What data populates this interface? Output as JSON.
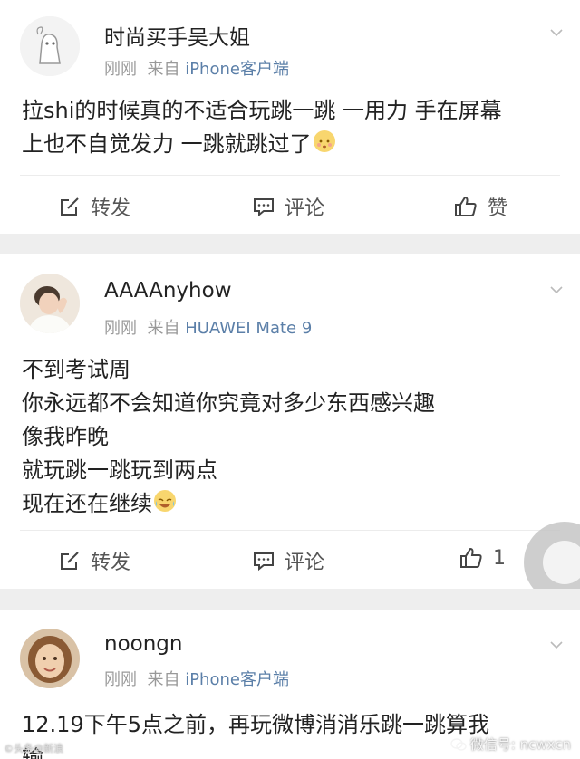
{
  "posts": [
    {
      "user": "时尚买手吴大姐",
      "time": "刚刚",
      "from": "来自",
      "source": "iPhone客户端",
      "lines": [
        "拉shi的时候真的不适合玩跳一跳 一用力 手在屏幕",
        "上也不自觉发力 一跳就跳过了"
      ],
      "emoji": "embarrassed-emoji",
      "actions": {
        "repost": "转发",
        "comment": "评论",
        "like": "赞"
      }
    },
    {
      "user": "AAAAnyhow",
      "time": "刚刚",
      "from": "来自",
      "source": "HUAWEI Mate 9",
      "lines": [
        "不到考试周",
        "你永远都不会知道你究竟对多少东西感兴趣",
        "像我昨晚",
        "就玩跳一跳玩到两点",
        "现在还在继续"
      ],
      "emoji": "laugh-cry-emoji",
      "actions": {
        "repost": "转发",
        "comment": "评论",
        "like": "1"
      }
    },
    {
      "user": "noongn",
      "time": "刚刚",
      "from": "来自",
      "source": "iPhone客户端",
      "lines": [
        "12.19下午5点之前，再玩微博消消乐跳一跳算我",
        "输"
      ]
    }
  ],
  "icons": {
    "repost": "edit-share-icon",
    "comment": "comment-bubble-icon",
    "like": "thumbs-up-icon",
    "menu": "chevron-down-icon"
  },
  "colors": {
    "source_link": "#5b7fa8",
    "meta": "#999999",
    "divider": "#eeeeee"
  },
  "watermarks": {
    "left": "©头条@新浪",
    "right": "微信号: ncwxcn"
  }
}
